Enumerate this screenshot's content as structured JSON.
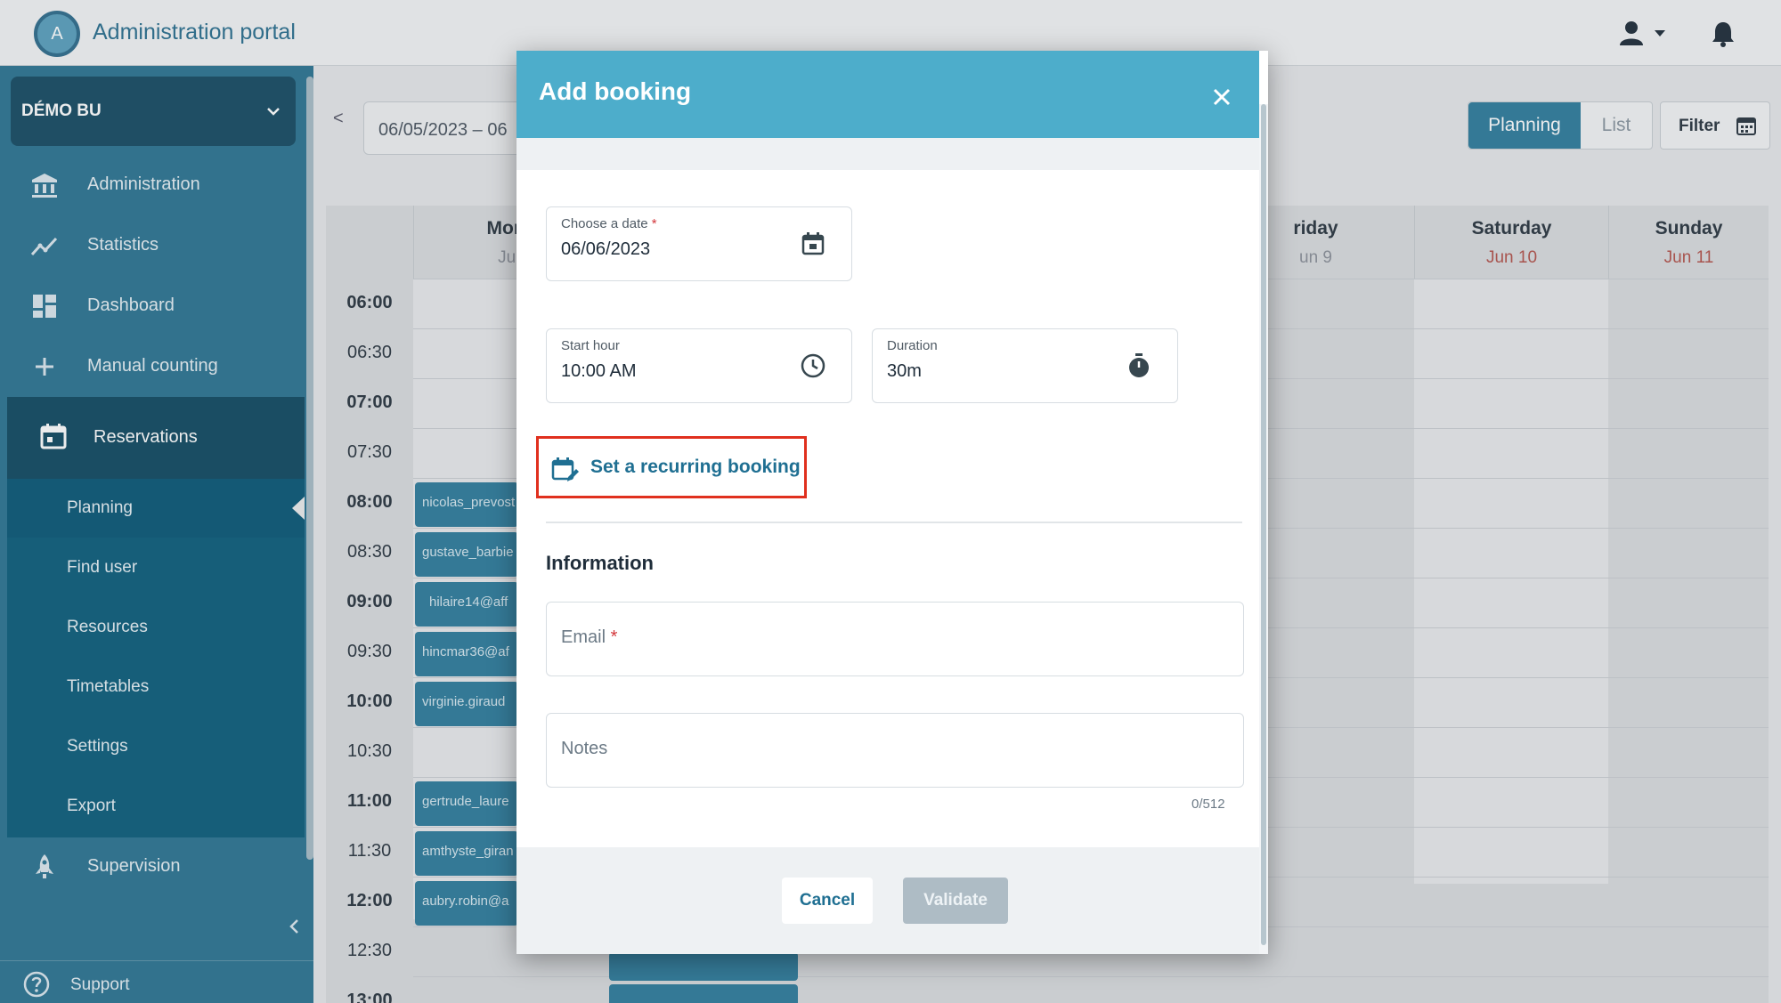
{
  "app": {
    "title": "Administration portal",
    "logo_letter": "A"
  },
  "header": {
    "user_icon": "user-icon",
    "bell_icon": "bell-icon"
  },
  "sidebar": {
    "business_unit": "DÉMO BU",
    "items": [
      {
        "label": "Administration",
        "icon": "bank-icon"
      },
      {
        "label": "Statistics",
        "icon": "chart-line-icon"
      },
      {
        "label": "Dashboard",
        "icon": "dashboard-icon"
      },
      {
        "label": "Manual counting",
        "icon": "plus-icon"
      }
    ],
    "reservations": {
      "label": "Reservations",
      "subitems": [
        "Planning",
        "Find user",
        "Resources",
        "Timetables",
        "Settings",
        "Export"
      ]
    },
    "supervision": "Supervision",
    "support": "Support"
  },
  "toolbar": {
    "prev": "<",
    "date_range": "06/05/2023 – 06",
    "view_planning": "Planning",
    "view_list": "List",
    "filter": "Filter"
  },
  "calendar": {
    "days": [
      {
        "name": "Mond",
        "date": "Jun"
      },
      {
        "name": "riday",
        "date": "un 9"
      },
      {
        "name": "Saturday",
        "date": "Jun 10"
      },
      {
        "name": "Sunday",
        "date": "Jun 11"
      }
    ],
    "times": [
      "06:00",
      "06:30",
      "07:00",
      "07:30",
      "08:00",
      "08:30",
      "09:00",
      "09:30",
      "10:00",
      "10:30",
      "11:00",
      "11:30",
      "12:00",
      "12:30",
      "13:00"
    ],
    "bookings": [
      "nicolas_prevost",
      "gustave_barbie",
      "hilaire14@aff",
      "hincmar36@af",
      "virginie.giraud",
      "",
      "gertrude_laure",
      "amthyste_giran",
      "aubry.robin@a"
    ]
  },
  "modal": {
    "title": "Add booking",
    "date_label": "Choose a date",
    "date_value": "06/06/2023",
    "start_label": "Start hour",
    "start_value": "10:00 AM",
    "duration_label": "Duration",
    "duration_value": "30m",
    "recurring": "Set a recurring booking",
    "info_title": "Information",
    "email_placeholder": "Email",
    "notes_placeholder": "Notes",
    "notes_counter": "0/512",
    "cancel": "Cancel",
    "validate": "Validate",
    "required_mark": "*"
  },
  "colors": {
    "primary": "#2f7d9c",
    "modal_header": "#4dadcb",
    "sidebar": "#2d7592",
    "highlight": "#e0301e",
    "required": "#d3373b"
  }
}
